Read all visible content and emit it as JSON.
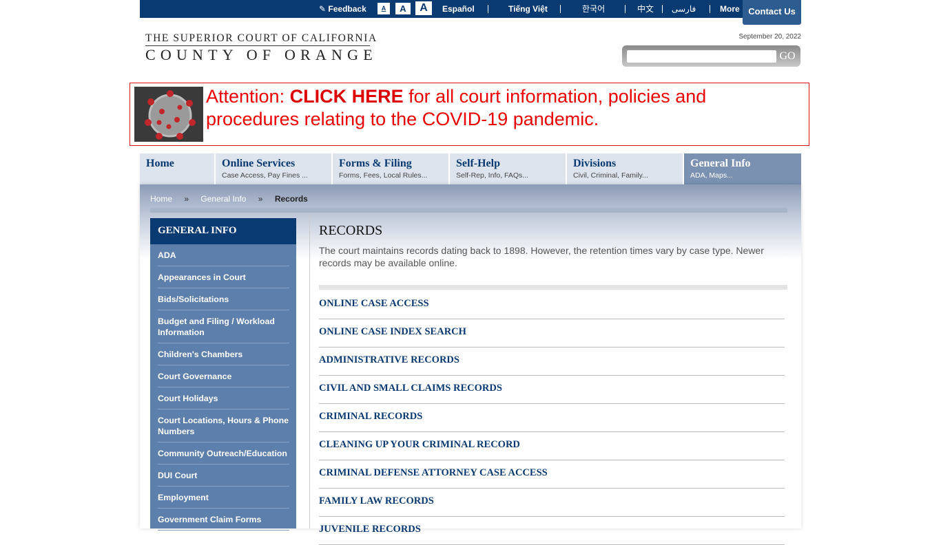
{
  "topbar": {
    "feedback": "Feedback",
    "text_sizes": [
      "A",
      "A",
      "A"
    ],
    "languages": [
      "Español",
      "Tiếng Việt",
      "한국어",
      "中文",
      "فارسی"
    ],
    "more": "More",
    "contact": "Contact Us"
  },
  "header": {
    "logo_line1": "THE SUPERIOR COURT OF CALIFORNIA",
    "logo_line2": "COUNTY OF ORANGE",
    "date": "September 20, 2022",
    "search_placeholder": "",
    "search_button": "GO"
  },
  "banner": {
    "prefix": "Attention: ",
    "link": "CLICK HERE",
    "suffix": " for all court information, policies and procedures relating to the COVID-19 pandemic."
  },
  "nav": [
    {
      "title": "Home",
      "sub": ""
    },
    {
      "title": "Online Services",
      "sub": "Case Access, Pay Fines ..."
    },
    {
      "title": "Forms & Filing",
      "sub": "Forms, Fees, Local Rules..."
    },
    {
      "title": "Self-Help",
      "sub": "Self-Rep, Info, FAQs..."
    },
    {
      "title": "Divisions",
      "sub": "Civil, Criminal, Family..."
    },
    {
      "title": "General Info",
      "sub": "ADA, Maps..."
    }
  ],
  "breadcrumb": [
    "Home",
    "»",
    "General Info",
    "»",
    "Records"
  ],
  "sidebar": {
    "title": "GENERAL INFO",
    "items": [
      "ADA",
      "Appearances in Court",
      "Bids/Solicitations",
      "Budget and Filing / Workload Information",
      "Children's Chambers",
      "Court Governance",
      "Court Holidays",
      "Court Locations, Hours & Phone Numbers",
      "Community Outreach/Education",
      "DUI Court",
      "Employment",
      "Government Claim Forms"
    ]
  },
  "main": {
    "title": "RECORDS",
    "intro": "The court maintains records dating back to 1898. However, the retention times vary by case type. Newer records may be available online.",
    "links": [
      "ONLINE CASE ACCESS",
      "ONLINE CASE INDEX SEARCH",
      "ADMINISTRATIVE RECORDS",
      "CIVIL AND SMALL CLAIMS RECORDS",
      "CRIMINAL RECORDS",
      "CLEANING UP YOUR CRIMINAL RECORD",
      "CRIMINAL DEFENSE ATTORNEY CASE ACCESS",
      "FAMILY LAW RECORDS",
      "JUVENILE RECORDS"
    ]
  },
  "colors": {
    "brand_navy": "#0a3a72",
    "sidebar_blue": "#5d7fab",
    "alert_red": "#e00000"
  }
}
